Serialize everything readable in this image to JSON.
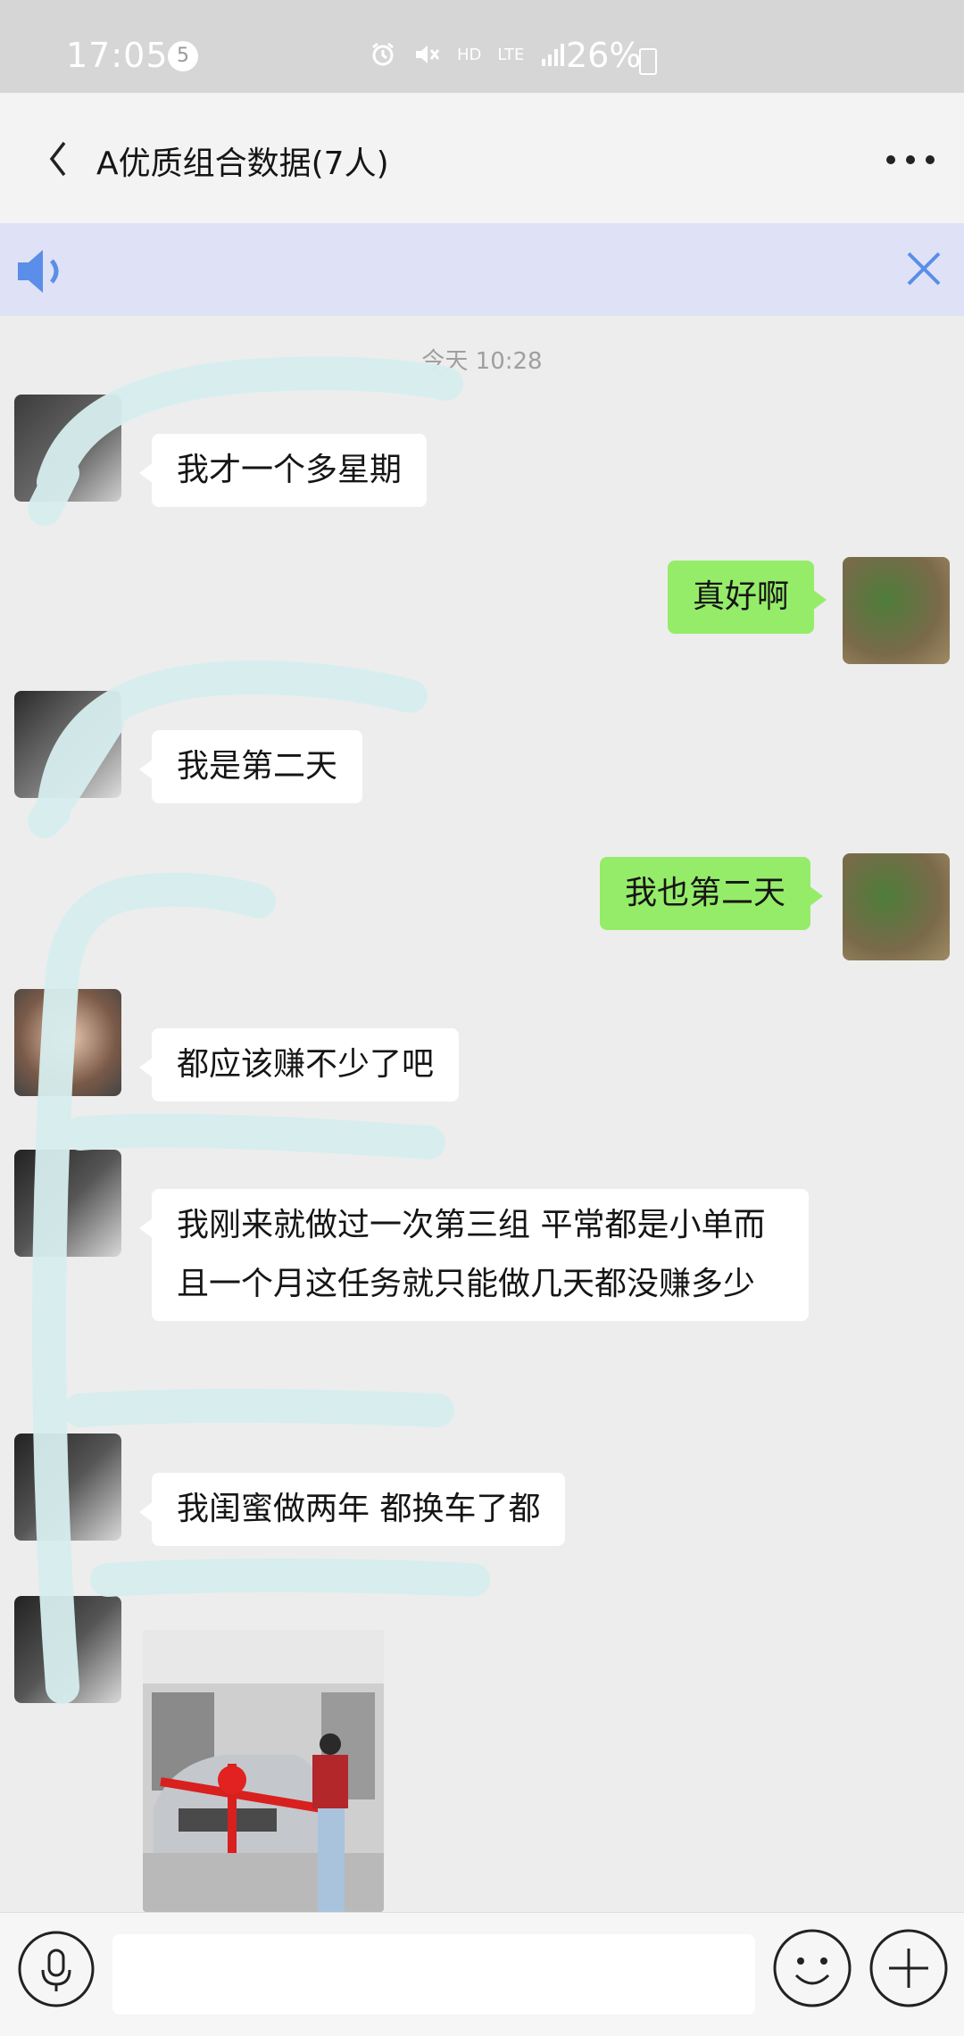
{
  "status_bar": {
    "time": "17:05",
    "notification_count": "5",
    "network_hd": "HD",
    "network_lte": "LTE",
    "battery": "26%"
  },
  "nav": {
    "title": "A优质组合数据(7人)",
    "back_icon": "chevron-left-icon",
    "more_icon": "more-dots-icon"
  },
  "notice": {
    "speaker_icon": "speaker-icon",
    "close_icon": "close-icon"
  },
  "chat": {
    "timestamp": "今天 10:28",
    "messages": [
      {
        "side": "them",
        "text": "我才一个多星期"
      },
      {
        "side": "me",
        "text": "真好啊"
      },
      {
        "side": "them",
        "text": "我是第二天"
      },
      {
        "side": "me",
        "text": "我也第二天"
      },
      {
        "side": "them",
        "text": "都应该赚不少了吧"
      },
      {
        "side": "them",
        "text": "我刚来就做过一次第三组 平常都是小单而且一个月这任务就只能做几天都没赚多少"
      },
      {
        "side": "them",
        "text": "我闺蜜做两年 都换车了都"
      },
      {
        "side": "them",
        "type": "image",
        "caption": ""
      }
    ]
  },
  "input_bar": {
    "voice_icon": "microphone-icon",
    "emoji_icon": "emoji-icon",
    "plus_icon": "plus-icon"
  },
  "colors": {
    "my_bubble": "#95ec69",
    "their_bubble": "#ffffff",
    "background": "#ededed",
    "notice_bg": "#dfe1f6"
  }
}
